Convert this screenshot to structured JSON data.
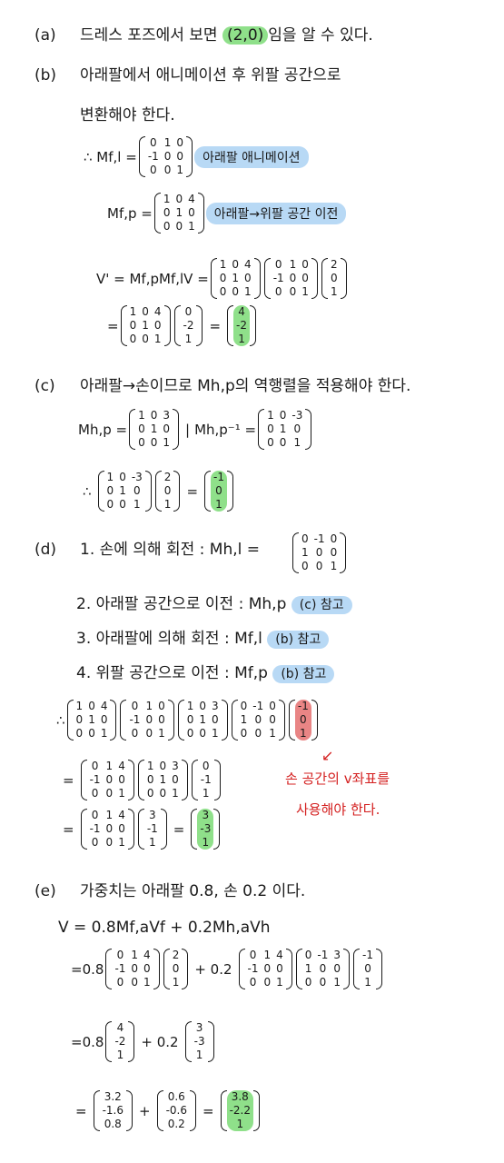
{
  "a": {
    "label": "(a)",
    "text1": "드레스 포즈에서 보면",
    "highlight": "(2,0)",
    "text2": "임을 알 수 있다."
  },
  "b": {
    "label": "(b)",
    "line1": "아래팔에서 애니메이션 후 위팔 공간으로",
    "line2": "변환해야 한다.",
    "mfl_lhs": "∴ Mf,l =",
    "mfl_note": "아래팔 애니메이션",
    "mfp_lhs": "Mf,p =",
    "mfp_note": "아래팔→위팔 공간 이전",
    "v_lhs": "V' = Mf,pMf,lV =",
    "eq": "=",
    "mfl": [
      [
        "0",
        "1",
        "0"
      ],
      [
        "-1",
        "0",
        "0"
      ],
      [
        "0",
        "0",
        "1"
      ]
    ],
    "mfp": [
      [
        "1",
        "0",
        "4"
      ],
      [
        "0",
        "1",
        "0"
      ],
      [
        "0",
        "0",
        "1"
      ]
    ],
    "v": [
      [
        "2"
      ],
      [
        "0"
      ],
      [
        "1"
      ]
    ],
    "mid": [
      [
        "0"
      ],
      [
        "-2"
      ],
      [
        "1"
      ]
    ],
    "result": [
      [
        "4"
      ],
      [
        "-2"
      ],
      [
        "1"
      ]
    ]
  },
  "c": {
    "label": "(c)",
    "line1": "아래팔→손이므로 Mh,p의 역행렬을 적용해야 한다.",
    "mhp_lhs": "Mh,p =",
    "mhp_inv_lhs": "Mh,p⁻¹ =",
    "sep": "|",
    "mhp": [
      [
        "1",
        "0",
        "3"
      ],
      [
        "0",
        "1",
        "0"
      ],
      [
        "0",
        "0",
        "1"
      ]
    ],
    "mhp_inv": [
      [
        "1",
        "0",
        "-3"
      ],
      [
        "0",
        "1",
        "0"
      ],
      [
        "0",
        "0",
        "1"
      ]
    ],
    "therefore": "∴",
    "eq": "=",
    "v": [
      [
        "2"
      ],
      [
        "0"
      ],
      [
        "1"
      ]
    ],
    "result": [
      [
        "-1"
      ],
      [
        "0"
      ],
      [
        "1"
      ]
    ]
  },
  "d": {
    "label": "(d)",
    "steps": [
      "1. 손에 의해 회전 : Mh,l =",
      "2. 아래팔 공간으로 이전 : Mh,p",
      "3. 아래팔에 의해 회전 : Mf,l",
      "4. 위팔 공간으로 이전 : Mf,p"
    ],
    "step_refs": [
      "",
      "(c) 참고",
      "(b) 참고",
      "(b) 참고"
    ],
    "mhl": [
      [
        "0",
        "-1",
        "0"
      ],
      [
        "1",
        "0",
        "0"
      ],
      [
        "0",
        "0",
        "1"
      ]
    ],
    "therefore": "∴",
    "eq": "=",
    "m1": [
      [
        "1",
        "0",
        "4"
      ],
      [
        "0",
        "1",
        "0"
      ],
      [
        "0",
        "0",
        "1"
      ]
    ],
    "m2": [
      [
        "0",
        "1",
        "0"
      ],
      [
        "-1",
        "0",
        "0"
      ],
      [
        "0",
        "0",
        "1"
      ]
    ],
    "m3": [
      [
        "1",
        "0",
        "3"
      ],
      [
        "0",
        "1",
        "0"
      ],
      [
        "0",
        "0",
        "1"
      ]
    ],
    "m4": [
      [
        "0",
        "-1",
        "0"
      ],
      [
        "1",
        "0",
        "0"
      ],
      [
        "0",
        "0",
        "1"
      ]
    ],
    "vh": [
      [
        "-1"
      ],
      [
        "0"
      ],
      [
        "1"
      ]
    ],
    "r1": [
      [
        "0",
        "1",
        "4"
      ],
      [
        "-1",
        "0",
        "0"
      ],
      [
        "0",
        "0",
        "1"
      ]
    ],
    "r2": [
      [
        "0"
      ],
      [
        "-1"
      ],
      [
        "1"
      ]
    ],
    "r3": [
      [
        "3"
      ],
      [
        "-1"
      ],
      [
        "1"
      ]
    ],
    "result": [
      [
        "3"
      ],
      [
        "-3"
      ],
      [
        "1"
      ]
    ],
    "red_note_1": "손 공간의 v좌표를",
    "red_note_2": "사용해야 한다."
  },
  "e": {
    "label": "(e)",
    "line1": "가중치는 아래팔 0.8, 손 0.2 이다.",
    "formula": "V = 0.8Mf,aVf + 0.2Mh,aVh",
    "eq": "=",
    "k1": "0.8",
    "k2": "+ 0.2",
    "plus": "+",
    "a1": [
      [
        "0",
        "1",
        "4"
      ],
      [
        "-1",
        "0",
        "0"
      ],
      [
        "0",
        "0",
        "1"
      ]
    ],
    "v1": [
      [
        "2"
      ],
      [
        "0"
      ],
      [
        "1"
      ]
    ],
    "a2": [
      [
        "0",
        "1",
        "4"
      ],
      [
        "-1",
        "0",
        "0"
      ],
      [
        "0",
        "0",
        "1"
      ]
    ],
    "a3": [
      [
        "0",
        "-1",
        "3"
      ],
      [
        "1",
        "0",
        "0"
      ],
      [
        "0",
        "0",
        "1"
      ]
    ],
    "v2": [
      [
        "-1"
      ],
      [
        "0"
      ],
      [
        "1"
      ]
    ],
    "s1": [
      [
        "4"
      ],
      [
        "-2"
      ],
      [
        "1"
      ]
    ],
    "s2": [
      [
        "3"
      ],
      [
        "-3"
      ],
      [
        "1"
      ]
    ],
    "p1": [
      [
        "3.2"
      ],
      [
        "-1.6"
      ],
      [
        "0.8"
      ]
    ],
    "p2": [
      [
        "0.6"
      ],
      [
        "-0.6"
      ],
      [
        "0.2"
      ]
    ],
    "result": [
      [
        "3.8"
      ],
      [
        "-2.2"
      ],
      [
        "1"
      ]
    ]
  }
}
